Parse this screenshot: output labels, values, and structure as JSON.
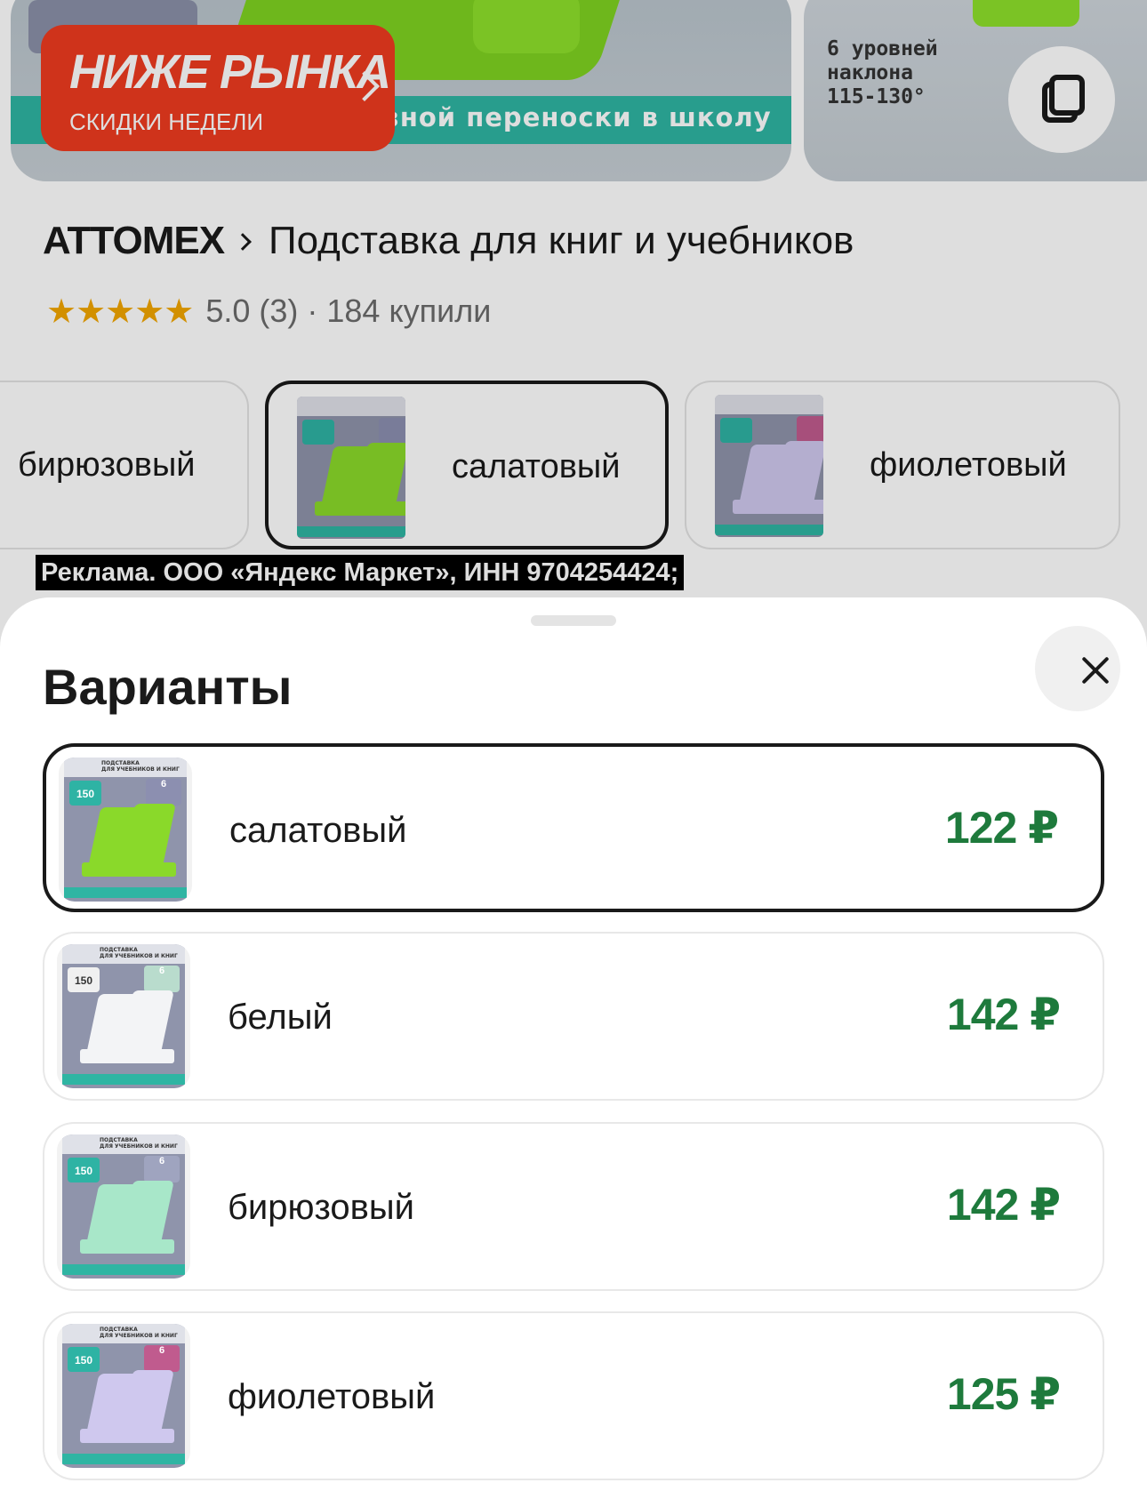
{
  "background": {
    "promo": {
      "title": "НИЖЕ РЫНКА",
      "subtitle": "СКИДКИ НЕДЕЛИ"
    },
    "gallery_banner_text": "зной переноски в школу",
    "gallery_specs": "6 уровней\nнаклона\n115-130°",
    "brand": "ATTOMEX",
    "product_title": "Подставка для книг и учебников",
    "rating_stars": "★★★★★",
    "rating_text": "5.0  (3) · 184 купили",
    "chips": [
      {
        "label": "бирюзовый"
      },
      {
        "label": "салатовый"
      },
      {
        "label": "фиолетовый"
      }
    ],
    "ad_text": "Реклама. ООО «Яндекс Маркет», ИНН 9704254424;"
  },
  "sheet": {
    "title": "Варианты",
    "close_icon": "close-icon",
    "options": [
      {
        "label": "салатовый",
        "price": "122 ₽",
        "selected": true
      },
      {
        "label": "белый",
        "price": "142 ₽",
        "selected": false
      },
      {
        "label": "бирюзовый",
        "price": "142 ₽",
        "selected": false
      },
      {
        "label": "фиолетовый",
        "price": "125 ₽",
        "selected": false
      }
    ]
  },
  "thumb_text": {
    "header": "ПОДСТАВКА\nДЛЯ УЧЕБНИКОВ И КНИГ",
    "badge_150": "150",
    "badge_6": "6"
  },
  "colors": {
    "price_green": "#1e7a3c",
    "promo_red": "#ee3b1f",
    "star_gold": "#f2a600"
  }
}
